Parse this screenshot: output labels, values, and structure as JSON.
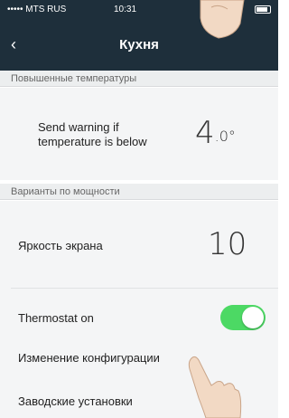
{
  "status_bar": {
    "carrier": "••••• MTS RUS",
    "time": "10:31"
  },
  "nav": {
    "back_icon": "chevron-left-icon",
    "back_glyph": "‹",
    "title": "Кухня"
  },
  "sections": {
    "high_temp_header": "Повышенные температуры",
    "power_header": "Варианты по мощности"
  },
  "temperature_warning": {
    "label_line1": "Send warning if",
    "label_line2": "temperature is below",
    "value": "4",
    "unit": ".0°"
  },
  "brightness": {
    "label": "Яркость экрана",
    "value": "10"
  },
  "thermostat": {
    "label": "Thermostat on",
    "enabled": true
  },
  "menu": {
    "config_change": "Изменение конфигурации",
    "factory_settings": "Заводские установки"
  },
  "colors": {
    "nav_bg": "#1e2f3b",
    "toggle_on": "#4cd964",
    "section_bg": "#eceeef"
  }
}
